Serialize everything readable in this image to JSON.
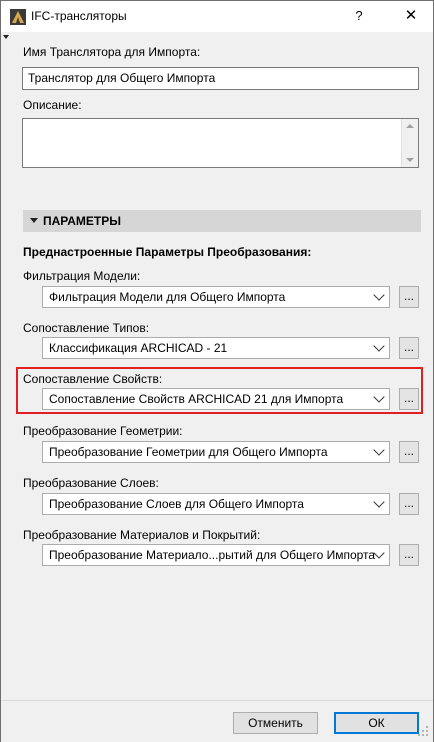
{
  "window": {
    "title": "IFC-трансляторы",
    "help_glyph": "?",
    "close_glyph": "✕"
  },
  "importTranslator": {
    "label": "Имя Транслятора для Импорта:",
    "value": "Транслятор для Общего Импорта"
  },
  "description": {
    "label": "Описание:",
    "value": ""
  },
  "section": {
    "title": "ПАРАМЕТРЫ"
  },
  "presets_heading": "Преднастроенные Параметры Преобразования:",
  "rows": [
    {
      "label": "Фильтрация Модели:",
      "value": "Фильтрация Модели для Общего Импорта",
      "button": "..."
    },
    {
      "label": "Сопоставление Типов:",
      "value": "Классификация ARCHICAD - 21",
      "button": "..."
    },
    {
      "label": "Сопоставление Свойств:",
      "value": "Сопоставление Свойств ARCHICAD 21 для Импорта",
      "button": "..."
    },
    {
      "label": "Преобразование Геометрии:",
      "value": "Преобразование Геометрии для Общего Импорта",
      "button": "..."
    },
    {
      "label": "Преобразование Слоев:",
      "value": "Преобразование Слоев для Общего Импорта",
      "button": "..."
    },
    {
      "label": "Преобразование Материалов и Покрытий:",
      "value": "Преобразование Материало...рытий для Общего Импорта",
      "button": "..."
    }
  ],
  "footer": {
    "cancel": "Отменить",
    "ok": "ОК"
  },
  "icons": {
    "app": "archicad-app-icon",
    "accent": "#0078d7",
    "highlight": "#e02020"
  }
}
